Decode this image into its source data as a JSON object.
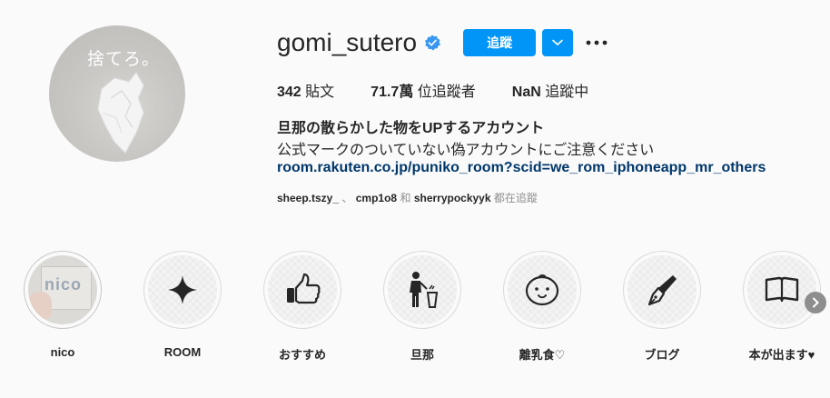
{
  "profile": {
    "avatar_text": "捨てろ。",
    "username": "gomi_sutero",
    "follow_label": "追蹤",
    "stats": [
      {
        "value": "342",
        "label": "貼文"
      },
      {
        "value": "71.7萬",
        "label": "位追蹤者"
      },
      {
        "value": "NaN",
        "label": "追蹤中"
      }
    ],
    "bio_title": "旦那の散らかした物をUPするアカウント",
    "bio_line": "公式マークのついていない偽アカウントにご注意ください",
    "bio_link": "room.rakuten.co.jp/puniko_room?scid=we_rom_iphoneapp_mr_others",
    "followed_by": {
      "name1": "sheep.tszy_",
      "sep": "、",
      "name2": "cmp1o8",
      "and": "和",
      "name3": "sherrypockyyk",
      "suffix": "都在追蹤"
    }
  },
  "highlights": [
    {
      "label": "nico",
      "icon": "nico-photo",
      "photo_text": "nico"
    },
    {
      "label": "ROOM",
      "icon": "sparkle-icon"
    },
    {
      "label": "おすすめ",
      "icon": "thumbs-up-icon"
    },
    {
      "label": "旦那",
      "icon": "trash-person-icon"
    },
    {
      "label": "離乳食♡",
      "icon": "baby-face-icon"
    },
    {
      "label": "ブログ",
      "icon": "pen-nib-icon"
    },
    {
      "label": "本が出ます♥",
      "icon": "book-icon"
    }
  ],
  "colors": {
    "accent": "#0095f6",
    "verified": "#3897f0",
    "link": "#00376b",
    "muted": "#8e8e8e"
  }
}
